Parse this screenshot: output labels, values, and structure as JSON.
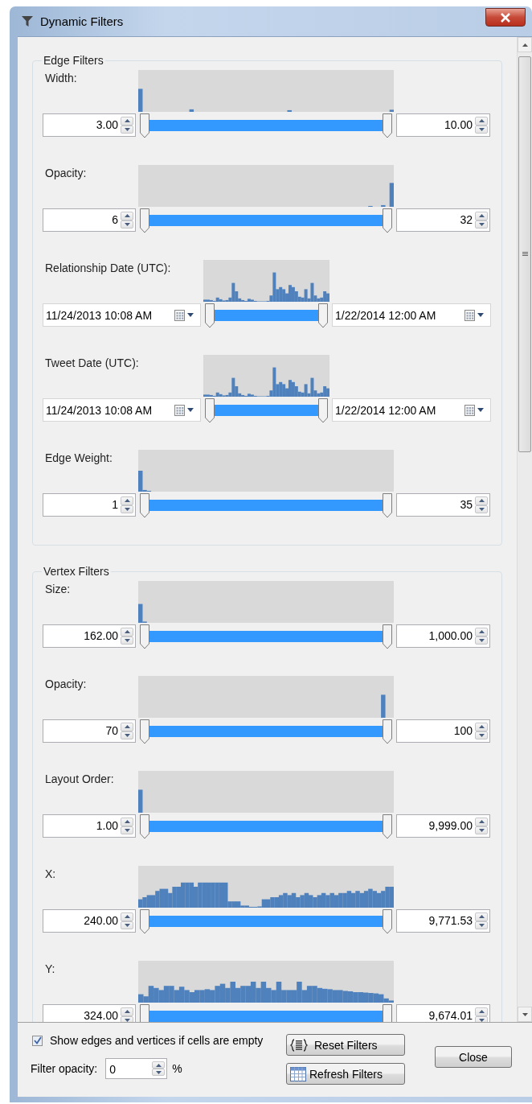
{
  "window": {
    "title": "Dynamic Filters"
  },
  "groups": [
    {
      "title": "Edge Filters",
      "filters": [
        {
          "kind": "number",
          "label": "Width:",
          "min": "3.00",
          "max": "10.00"
        },
        {
          "kind": "number",
          "label": "Opacity:",
          "min": "6",
          "max": "32"
        },
        {
          "kind": "date",
          "label": "Relationship Date (UTC):",
          "min": "11/24/2013 10:08 AM",
          "max": "1/22/2014 12:00 AM"
        },
        {
          "kind": "date",
          "label": "Tweet Date (UTC):",
          "min": "11/24/2013 10:08 AM",
          "max": "1/22/2014 12:00 AM"
        },
        {
          "kind": "number",
          "label": "Edge Weight:",
          "min": "1",
          "max": "35"
        }
      ]
    },
    {
      "title": "Vertex Filters",
      "filters": [
        {
          "kind": "number",
          "label": "Size:",
          "min": "162.00",
          "max": "1,000.00"
        },
        {
          "kind": "number",
          "label": "Opacity:",
          "min": "70",
          "max": "100"
        },
        {
          "kind": "number",
          "label": "Layout Order:",
          "min": "1.00",
          "max": "9,999.00"
        },
        {
          "kind": "number",
          "label": "X:",
          "min": "240.00",
          "max": "9,771.53"
        },
        {
          "kind": "number",
          "label": "Y:",
          "min": "324.00",
          "max": "9,674.01"
        }
      ]
    }
  ],
  "footer": {
    "show_empty": {
      "label": "Show edges and vertices if cells are empty",
      "checked": true
    },
    "filter_opacity": {
      "label": "Filter opacity:",
      "value": "0",
      "unit": "%"
    },
    "buttons": [
      {
        "kind": "reset",
        "label": "Reset Filters"
      },
      {
        "kind": "refresh",
        "label": "Refresh Filters"
      },
      {
        "kind": "close",
        "label": "Close"
      }
    ]
  }
}
